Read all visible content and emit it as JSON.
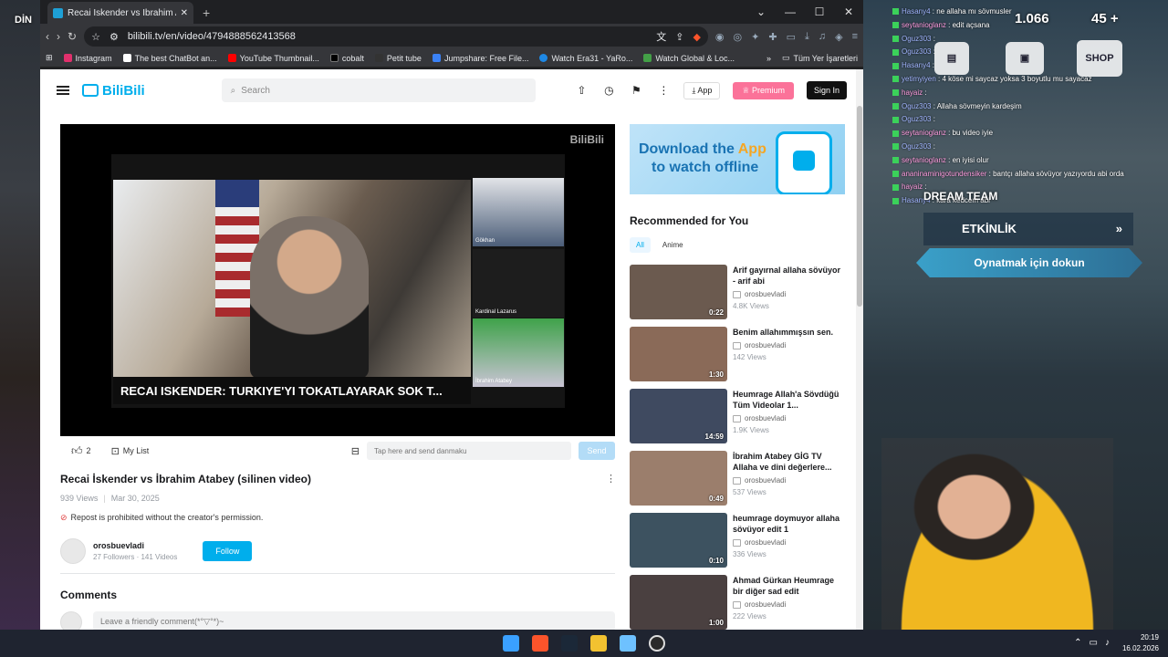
{
  "browser": {
    "tab_title": "Recai İskender vs İbrahim Atab",
    "url": "bilibili.tv/en/video/4794888562413568",
    "bookmarks": [
      "Instagram",
      "The best ChatBot an...",
      "YouTube Thumbnail...",
      "cobalt",
      "Petit tube",
      "Jumpshare: Free File...",
      "Watch Era31 - YaRo...",
      "Watch Global & Loc..."
    ],
    "bookmarks_more": "Tüm Yer İşaretleri"
  },
  "site": {
    "logo": "BiliBili",
    "search_placeholder": "Search",
    "app_label": "App",
    "premium_label": "Premium",
    "signin_label": "Sign In"
  },
  "player": {
    "watermark": "BiliBili",
    "lower_third": "RECAI ISKENDER: TURKIYE'YI TOKATLAYARAK SOK T...",
    "cam_labels": [
      "Gökhan",
      "Kardinal Lazarus",
      "İbrahim Atabey"
    ]
  },
  "actions": {
    "likes": "2",
    "mylist": "My List",
    "danmaku_placeholder": "Tap here and send danmaku",
    "send": "Send"
  },
  "video": {
    "title": "Recai İskender vs İbrahim Atabey (silinen video)",
    "views": "939 Views",
    "date": "Mar 30, 2025",
    "repost_notice": "Repost is prohibited without the creator's permission."
  },
  "uploader": {
    "name": "orosbuevladi",
    "stats": "27 Followers · 141 Videos",
    "follow": "Follow"
  },
  "comments": {
    "heading": "Comments",
    "placeholder": "Leave a friendly comment(*°▽°*)~"
  },
  "banner": {
    "line1_a": "Download the ",
    "line1_b": "App",
    "line2": "to watch offline"
  },
  "recommended": {
    "heading": "Recommended for You",
    "tabs": [
      "All",
      "Anime"
    ],
    "items": [
      {
        "title": "Arif gayırnal allaha sövüyor - arif abi",
        "uploader": "orosbuevladi",
        "views": "4.8K Views",
        "duration": "0:22",
        "color": "#6b5a4f"
      },
      {
        "title": "Benim allahımmışsın sen.",
        "uploader": "orosbuevladi",
        "views": "142 Views",
        "duration": "1:30",
        "color": "#8a6a58"
      },
      {
        "title": "Heumrage Allah'a Sövdüğü Tüm Videolar 1...",
        "uploader": "orosbuevladi",
        "views": "1.9K Views",
        "duration": "14:59",
        "color": "#3f4a60"
      },
      {
        "title": "İbrahim Atabey GİG TV Allaha ve dini değerlere...",
        "uploader": "orosbuevladi",
        "views": "537 Views",
        "duration": "0:49",
        "color": "#9b7e6c"
      },
      {
        "title": "heumrage doymuyor allaha sövüyor edit 1",
        "uploader": "orosbuevladi",
        "views": "336 Views",
        "duration": "0:10",
        "color": "#3d5260"
      },
      {
        "title": "Ahmad Gürkan Heumrage bir diğer sad edit",
        "uploader": "orosbuevladi",
        "views": "222 Views",
        "duration": "1:00",
        "color": "#4a4040"
      }
    ]
  },
  "overlay": {
    "chat": [
      {
        "user": "Hasany4",
        "msg": " : ne allaha mı sövmusler"
      },
      {
        "user": "seytanioglanz",
        "msg": " : edit açsana",
        "pink": true
      },
      {
        "user": "Oguz303",
        "msg": " :"
      },
      {
        "user": "Oguz303",
        "msg": " :"
      },
      {
        "user": "Hasany4",
        "msg": " :"
      },
      {
        "user": "yetimyiyen",
        "msg": " : 4 köse mi saycaz yoksa 3 boyutlu mu sayacaz"
      },
      {
        "user": "hayaiz",
        "msg": " :",
        "pink": true
      },
      {
        "user": "Oguz303",
        "msg": " : Allaha sövmeyin kardeşim"
      },
      {
        "user": "Oguz303",
        "msg": " :"
      },
      {
        "user": "seytanioglanz",
        "msg": " : bu video iyie",
        "pink": true
      },
      {
        "user": "Oguz303",
        "msg": " :"
      },
      {
        "user": "seytanioglanz",
        "msg": " : en iyisi olur",
        "pink": true
      },
      {
        "user": "ananinaminigotundensiker",
        "msg": " : bantçı allaha sövüyor yazıyordu abi orda",
        "pink": true
      },
      {
        "user": "hayaiz",
        "msg": " :",
        "pink": true
      },
      {
        "user": "Hasany4",
        "msg": " : kara kedcem abi"
      }
    ],
    "coins": "1.066",
    "uc": "45 +",
    "shop": "SHOP",
    "etkinlik": "ETKİNLİK",
    "play": "Oynatmak için dokun",
    "dream_team": "DREAM TEAM",
    "side_text": "DİN"
  },
  "taskbar": {
    "time": "20:19",
    "date": "16.02.2026"
  }
}
